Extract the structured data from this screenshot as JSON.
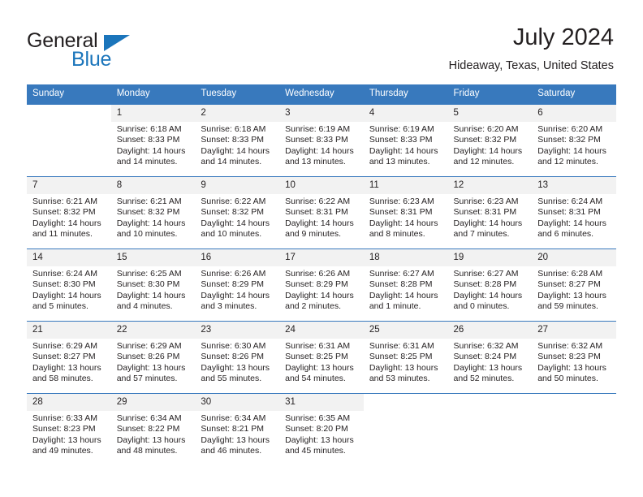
{
  "brand": {
    "name_part1": "General",
    "name_part2": "Blue",
    "accent_color": "#1b75bb",
    "logo_icon": "triangle-icon"
  },
  "header": {
    "title": "July 2024",
    "subtitle": "Hideaway, Texas, United States"
  },
  "calendar": {
    "header_bg": "#3879bd",
    "daynum_bg": "#f2f2f2",
    "weekdays": [
      "Sunday",
      "Monday",
      "Tuesday",
      "Wednesday",
      "Thursday",
      "Friday",
      "Saturday"
    ],
    "weeks": [
      [
        {
          "day": "",
          "lines": []
        },
        {
          "day": "1",
          "lines": [
            "Sunrise: 6:18 AM",
            "Sunset: 8:33 PM",
            "Daylight: 14 hours",
            "and 14 minutes."
          ]
        },
        {
          "day": "2",
          "lines": [
            "Sunrise: 6:18 AM",
            "Sunset: 8:33 PM",
            "Daylight: 14 hours",
            "and 14 minutes."
          ]
        },
        {
          "day": "3",
          "lines": [
            "Sunrise: 6:19 AM",
            "Sunset: 8:33 PM",
            "Daylight: 14 hours",
            "and 13 minutes."
          ]
        },
        {
          "day": "4",
          "lines": [
            "Sunrise: 6:19 AM",
            "Sunset: 8:33 PM",
            "Daylight: 14 hours",
            "and 13 minutes."
          ]
        },
        {
          "day": "5",
          "lines": [
            "Sunrise: 6:20 AM",
            "Sunset: 8:32 PM",
            "Daylight: 14 hours",
            "and 12 minutes."
          ]
        },
        {
          "day": "6",
          "lines": [
            "Sunrise: 6:20 AM",
            "Sunset: 8:32 PM",
            "Daylight: 14 hours",
            "and 12 minutes."
          ]
        }
      ],
      [
        {
          "day": "7",
          "lines": [
            "Sunrise: 6:21 AM",
            "Sunset: 8:32 PM",
            "Daylight: 14 hours",
            "and 11 minutes."
          ]
        },
        {
          "day": "8",
          "lines": [
            "Sunrise: 6:21 AM",
            "Sunset: 8:32 PM",
            "Daylight: 14 hours",
            "and 10 minutes."
          ]
        },
        {
          "day": "9",
          "lines": [
            "Sunrise: 6:22 AM",
            "Sunset: 8:32 PM",
            "Daylight: 14 hours",
            "and 10 minutes."
          ]
        },
        {
          "day": "10",
          "lines": [
            "Sunrise: 6:22 AM",
            "Sunset: 8:31 PM",
            "Daylight: 14 hours",
            "and 9 minutes."
          ]
        },
        {
          "day": "11",
          "lines": [
            "Sunrise: 6:23 AM",
            "Sunset: 8:31 PM",
            "Daylight: 14 hours",
            "and 8 minutes."
          ]
        },
        {
          "day": "12",
          "lines": [
            "Sunrise: 6:23 AM",
            "Sunset: 8:31 PM",
            "Daylight: 14 hours",
            "and 7 minutes."
          ]
        },
        {
          "day": "13",
          "lines": [
            "Sunrise: 6:24 AM",
            "Sunset: 8:31 PM",
            "Daylight: 14 hours",
            "and 6 minutes."
          ]
        }
      ],
      [
        {
          "day": "14",
          "lines": [
            "Sunrise: 6:24 AM",
            "Sunset: 8:30 PM",
            "Daylight: 14 hours",
            "and 5 minutes."
          ]
        },
        {
          "day": "15",
          "lines": [
            "Sunrise: 6:25 AM",
            "Sunset: 8:30 PM",
            "Daylight: 14 hours",
            "and 4 minutes."
          ]
        },
        {
          "day": "16",
          "lines": [
            "Sunrise: 6:26 AM",
            "Sunset: 8:29 PM",
            "Daylight: 14 hours",
            "and 3 minutes."
          ]
        },
        {
          "day": "17",
          "lines": [
            "Sunrise: 6:26 AM",
            "Sunset: 8:29 PM",
            "Daylight: 14 hours",
            "and 2 minutes."
          ]
        },
        {
          "day": "18",
          "lines": [
            "Sunrise: 6:27 AM",
            "Sunset: 8:28 PM",
            "Daylight: 14 hours",
            "and 1 minute."
          ]
        },
        {
          "day": "19",
          "lines": [
            "Sunrise: 6:27 AM",
            "Sunset: 8:28 PM",
            "Daylight: 14 hours",
            "and 0 minutes."
          ]
        },
        {
          "day": "20",
          "lines": [
            "Sunrise: 6:28 AM",
            "Sunset: 8:27 PM",
            "Daylight: 13 hours",
            "and 59 minutes."
          ]
        }
      ],
      [
        {
          "day": "21",
          "lines": [
            "Sunrise: 6:29 AM",
            "Sunset: 8:27 PM",
            "Daylight: 13 hours",
            "and 58 minutes."
          ]
        },
        {
          "day": "22",
          "lines": [
            "Sunrise: 6:29 AM",
            "Sunset: 8:26 PM",
            "Daylight: 13 hours",
            "and 57 minutes."
          ]
        },
        {
          "day": "23",
          "lines": [
            "Sunrise: 6:30 AM",
            "Sunset: 8:26 PM",
            "Daylight: 13 hours",
            "and 55 minutes."
          ]
        },
        {
          "day": "24",
          "lines": [
            "Sunrise: 6:31 AM",
            "Sunset: 8:25 PM",
            "Daylight: 13 hours",
            "and 54 minutes."
          ]
        },
        {
          "day": "25",
          "lines": [
            "Sunrise: 6:31 AM",
            "Sunset: 8:25 PM",
            "Daylight: 13 hours",
            "and 53 minutes."
          ]
        },
        {
          "day": "26",
          "lines": [
            "Sunrise: 6:32 AM",
            "Sunset: 8:24 PM",
            "Daylight: 13 hours",
            "and 52 minutes."
          ]
        },
        {
          "day": "27",
          "lines": [
            "Sunrise: 6:32 AM",
            "Sunset: 8:23 PM",
            "Daylight: 13 hours",
            "and 50 minutes."
          ]
        }
      ],
      [
        {
          "day": "28",
          "lines": [
            "Sunrise: 6:33 AM",
            "Sunset: 8:23 PM",
            "Daylight: 13 hours",
            "and 49 minutes."
          ]
        },
        {
          "day": "29",
          "lines": [
            "Sunrise: 6:34 AM",
            "Sunset: 8:22 PM",
            "Daylight: 13 hours",
            "and 48 minutes."
          ]
        },
        {
          "day": "30",
          "lines": [
            "Sunrise: 6:34 AM",
            "Sunset: 8:21 PM",
            "Daylight: 13 hours",
            "and 46 minutes."
          ]
        },
        {
          "day": "31",
          "lines": [
            "Sunrise: 6:35 AM",
            "Sunset: 8:20 PM",
            "Daylight: 13 hours",
            "and 45 minutes."
          ]
        },
        {
          "day": "",
          "lines": []
        },
        {
          "day": "",
          "lines": []
        },
        {
          "day": "",
          "lines": []
        }
      ]
    ]
  }
}
